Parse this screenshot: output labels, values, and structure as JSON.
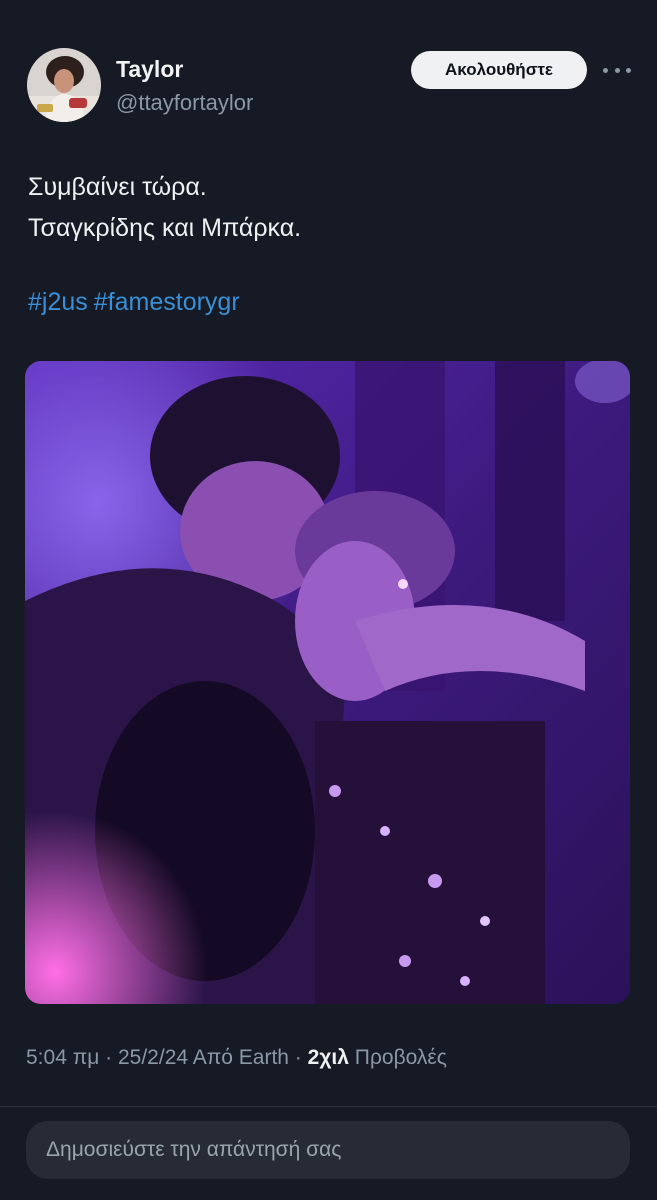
{
  "author": {
    "display_name": "Taylor",
    "handle": "@ttayfortaylor",
    "avatar_icon": "profile-photo"
  },
  "header": {
    "follow_label": "Ακολουθήστε",
    "more_icon": "more-horizontal-icon"
  },
  "tweet": {
    "lines": [
      "Συμβαίνει τώρα.",
      "Τσαγκρίδης και Μπάρκα."
    ],
    "hashtags": [
      "#j2us",
      "#famestorygr"
    ]
  },
  "meta": {
    "time": "5:04 πμ",
    "separator": "·",
    "date": "25/2/24",
    "source": "Από Earth",
    "views_count": "2χιλ",
    "views_label": "Προβολές"
  },
  "reply": {
    "placeholder": "Δημοσιεύστε την απάντησή σας"
  },
  "colors": {
    "background": "#151a24",
    "hashtag": "#3b8fd6",
    "muted": "#8b98a5",
    "follow_bg": "#eff1f2",
    "media_tint": "#7a2fd8"
  }
}
